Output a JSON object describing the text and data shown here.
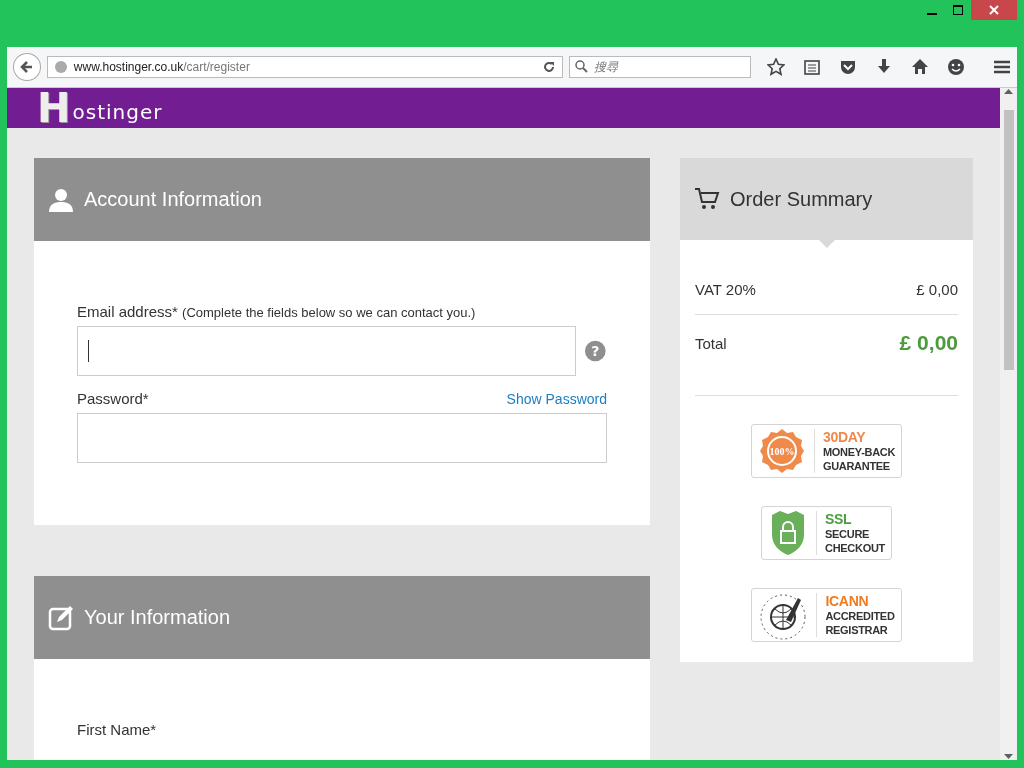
{
  "browser": {
    "url_host": "www.hostinger.co.uk",
    "url_path": "/cart/register",
    "search": {
      "placeholder": "搜尋"
    }
  },
  "site": {
    "logo_initial": "H",
    "logo_rest": "ostinger"
  },
  "account": {
    "title": "Account Information",
    "email": {
      "label": "Email address*",
      "hint": "(Complete the fields below so we can contact you.)",
      "focused": true,
      "help": "?"
    },
    "password": {
      "label": "Password*",
      "link": "Show Password"
    }
  },
  "your_info": {
    "title": "Your Information",
    "first_name": {
      "label": "First Name*"
    }
  },
  "order_summary": {
    "title": "Order Summary",
    "rows": [
      {
        "kind": "line",
        "label": "VAT 20%",
        "value": "£ 0,00"
      },
      {
        "kind": "total",
        "label": "Total",
        "value": "£ 0,00"
      }
    ],
    "badges": [
      {
        "kind": "guarantee",
        "seal": "100%",
        "lines": [
          "30DAY",
          "MONEY-BACK",
          "GUARANTEE"
        ]
      },
      {
        "kind": "ssl",
        "lines": [
          "SSL",
          "SECURE",
          "CHECKOUT"
        ]
      },
      {
        "kind": "icann",
        "lines": [
          "ICANN",
          "ACCREDITED",
          "REGISTRAR"
        ]
      }
    ]
  }
}
